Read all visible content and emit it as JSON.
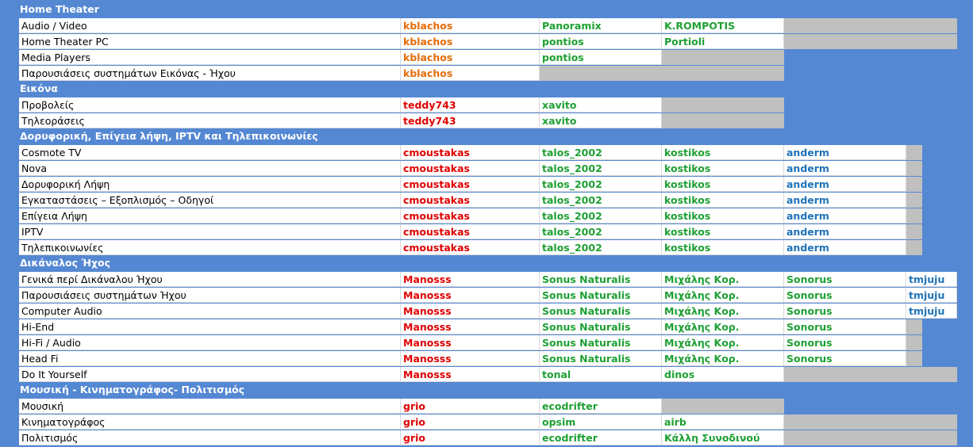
{
  "colors": {
    "background": "#5588d3",
    "header_text": "#ffffff",
    "empty_cell": "#c0c0c0",
    "orange": "#e46c0a",
    "red": "#e00000",
    "green": "#1ea033",
    "blue": "#1f73b8"
  },
  "sections": [
    {
      "title": "Home Theater",
      "rows": [
        {
          "forum": "Audio / Video",
          "moderators": [
            {
              "name": "kblachos",
              "color": "orange"
            },
            {
              "name": "Panoramix",
              "color": "green"
            },
            {
              "name": "K.ROMPOTIS",
              "color": "green"
            }
          ]
        },
        {
          "forum": "Home Theater PC",
          "moderators": [
            {
              "name": "kblachos",
              "color": "orange"
            },
            {
              "name": "pontios",
              "color": "green"
            },
            {
              "name": "Portioli",
              "color": "green"
            }
          ]
        },
        {
          "forum": "Media Players",
          "moderators": [
            {
              "name": "kblachos",
              "color": "orange"
            },
            {
              "name": "pontios",
              "color": "green"
            }
          ]
        },
        {
          "forum": "Παρουσιάσεις συστημάτων Εικόνας - Ήχου",
          "moderators": [
            {
              "name": "kblachos",
              "color": "orange"
            }
          ]
        }
      ]
    },
    {
      "title": "Εικόνα",
      "rows": [
        {
          "forum": "Προβολείς",
          "moderators": [
            {
              "name": "teddy743",
              "color": "red"
            },
            {
              "name": "xavito",
              "color": "green"
            }
          ]
        },
        {
          "forum": "Τηλεοράσεις",
          "moderators": [
            {
              "name": "teddy743",
              "color": "red"
            },
            {
              "name": "xavito",
              "color": "green"
            }
          ]
        }
      ]
    },
    {
      "title": "Δορυφορική, Επίγεια λήψη, IPTV και Τηλεπικοινωνίες",
      "rows": [
        {
          "forum": "Cosmote TV",
          "moderators": [
            {
              "name": "cmoustakas",
              "color": "red"
            },
            {
              "name": "talos_2002",
              "color": "green"
            },
            {
              "name": "kostikos",
              "color": "green"
            },
            {
              "name": "anderm",
              "color": "blue"
            }
          ]
        },
        {
          "forum": "Nova",
          "moderators": [
            {
              "name": "cmoustakas",
              "color": "red"
            },
            {
              "name": "talos_2002",
              "color": "green"
            },
            {
              "name": "kostikos",
              "color": "green"
            },
            {
              "name": "anderm",
              "color": "blue"
            }
          ]
        },
        {
          "forum": "Δορυφορική Λήψη",
          "moderators": [
            {
              "name": "cmoustakas",
              "color": "red"
            },
            {
              "name": "talos_2002",
              "color": "green"
            },
            {
              "name": "kostikos",
              "color": "green"
            },
            {
              "name": "anderm",
              "color": "blue"
            }
          ]
        },
        {
          "forum": "Εγκαταστάσεις – Εξοπλισμός – Οδηγοί",
          "moderators": [
            {
              "name": "cmoustakas",
              "color": "red"
            },
            {
              "name": "talos_2002",
              "color": "green"
            },
            {
              "name": "kostikos",
              "color": "green"
            },
            {
              "name": "anderm",
              "color": "blue"
            }
          ]
        },
        {
          "forum": "Επίγεια Λήψη",
          "moderators": [
            {
              "name": "cmoustakas",
              "color": "red"
            },
            {
              "name": "talos_2002",
              "color": "green"
            },
            {
              "name": "kostikos",
              "color": "green"
            },
            {
              "name": "anderm",
              "color": "blue"
            }
          ]
        },
        {
          "forum": "IPTV",
          "moderators": [
            {
              "name": "cmoustakas",
              "color": "red"
            },
            {
              "name": "talos_2002",
              "color": "green"
            },
            {
              "name": "kostikos",
              "color": "green"
            },
            {
              "name": "anderm",
              "color": "blue"
            }
          ]
        },
        {
          "forum": "Τηλεπικοινωνίες",
          "moderators": [
            {
              "name": "cmoustakas",
              "color": "red"
            },
            {
              "name": "talos_2002",
              "color": "green"
            },
            {
              "name": "kostikos",
              "color": "green"
            },
            {
              "name": "anderm",
              "color": "blue"
            }
          ]
        }
      ]
    },
    {
      "title": "Δικάναλος Ήχος",
      "rows": [
        {
          "forum": "Γενικά περί Δικάναλου Ήχου",
          "moderators": [
            {
              "name": "Manosss",
              "color": "red"
            },
            {
              "name": "Sonus Naturalis",
              "color": "green"
            },
            {
              "name": "Μιχάλης Κορ.",
              "color": "green"
            },
            {
              "name": "Sonorus",
              "color": "green"
            },
            {
              "name": "tmjuju",
              "color": "blue"
            }
          ]
        },
        {
          "forum": "Παρουσιάσεις συστημάτων Ήχου",
          "moderators": [
            {
              "name": "Manosss",
              "color": "red"
            },
            {
              "name": "Sonus Naturalis",
              "color": "green"
            },
            {
              "name": "Μιχάλης Κορ.",
              "color": "green"
            },
            {
              "name": "Sonorus",
              "color": "green"
            },
            {
              "name": "tmjuju",
              "color": "blue"
            }
          ]
        },
        {
          "forum": "Computer Audio",
          "moderators": [
            {
              "name": "Manosss",
              "color": "red"
            },
            {
              "name": "Sonus Naturalis",
              "color": "green"
            },
            {
              "name": "Μιχάλης Κορ.",
              "color": "green"
            },
            {
              "name": "Sonorus",
              "color": "green"
            },
            {
              "name": "tmjuju",
              "color": "blue"
            }
          ]
        },
        {
          "forum": "Hi-End",
          "moderators": [
            {
              "name": "Manosss",
              "color": "red"
            },
            {
              "name": "Sonus Naturalis",
              "color": "green"
            },
            {
              "name": "Μιχάλης Κορ.",
              "color": "green"
            },
            {
              "name": "Sonorus",
              "color": "green"
            }
          ]
        },
        {
          "forum": "Hi-Fi / Audio",
          "moderators": [
            {
              "name": "Manosss",
              "color": "red"
            },
            {
              "name": "Sonus Naturalis",
              "color": "green"
            },
            {
              "name": "Μιχάλης Κορ.",
              "color": "green"
            },
            {
              "name": "Sonorus",
              "color": "green"
            }
          ]
        },
        {
          "forum": "Head Fi",
          "moderators": [
            {
              "name": "Manosss",
              "color": "red"
            },
            {
              "name": "Sonus Naturalis",
              "color": "green"
            },
            {
              "name": "Μιχάλης Κορ.",
              "color": "green"
            },
            {
              "name": "Sonorus",
              "color": "green"
            }
          ]
        },
        {
          "forum": "Do It Yourself",
          "moderators": [
            {
              "name": "Manosss",
              "color": "red"
            },
            {
              "name": "tonal",
              "color": "green"
            },
            {
              "name": "dinos",
              "color": "green"
            }
          ]
        }
      ]
    },
    {
      "title": "Μουσική - Κινηματογράφος- Πολιτισμός",
      "rows": [
        {
          "forum": "Μουσική",
          "moderators": [
            {
              "name": "grio",
              "color": "red"
            },
            {
              "name": "ecodrifter",
              "color": "green"
            }
          ]
        },
        {
          "forum": "Κινηματογράφος",
          "moderators": [
            {
              "name": "grio",
              "color": "red"
            },
            {
              "name": "opsim",
              "color": "green"
            },
            {
              "name": "airb",
              "color": "green"
            }
          ]
        },
        {
          "forum": "Πολιτισμός",
          "moderators": [
            {
              "name": "grio",
              "color": "red"
            },
            {
              "name": "ecodrifter",
              "color": "green"
            },
            {
              "name": "Κάλλη Συνοδινού",
              "color": "green"
            }
          ]
        }
      ]
    }
  ]
}
